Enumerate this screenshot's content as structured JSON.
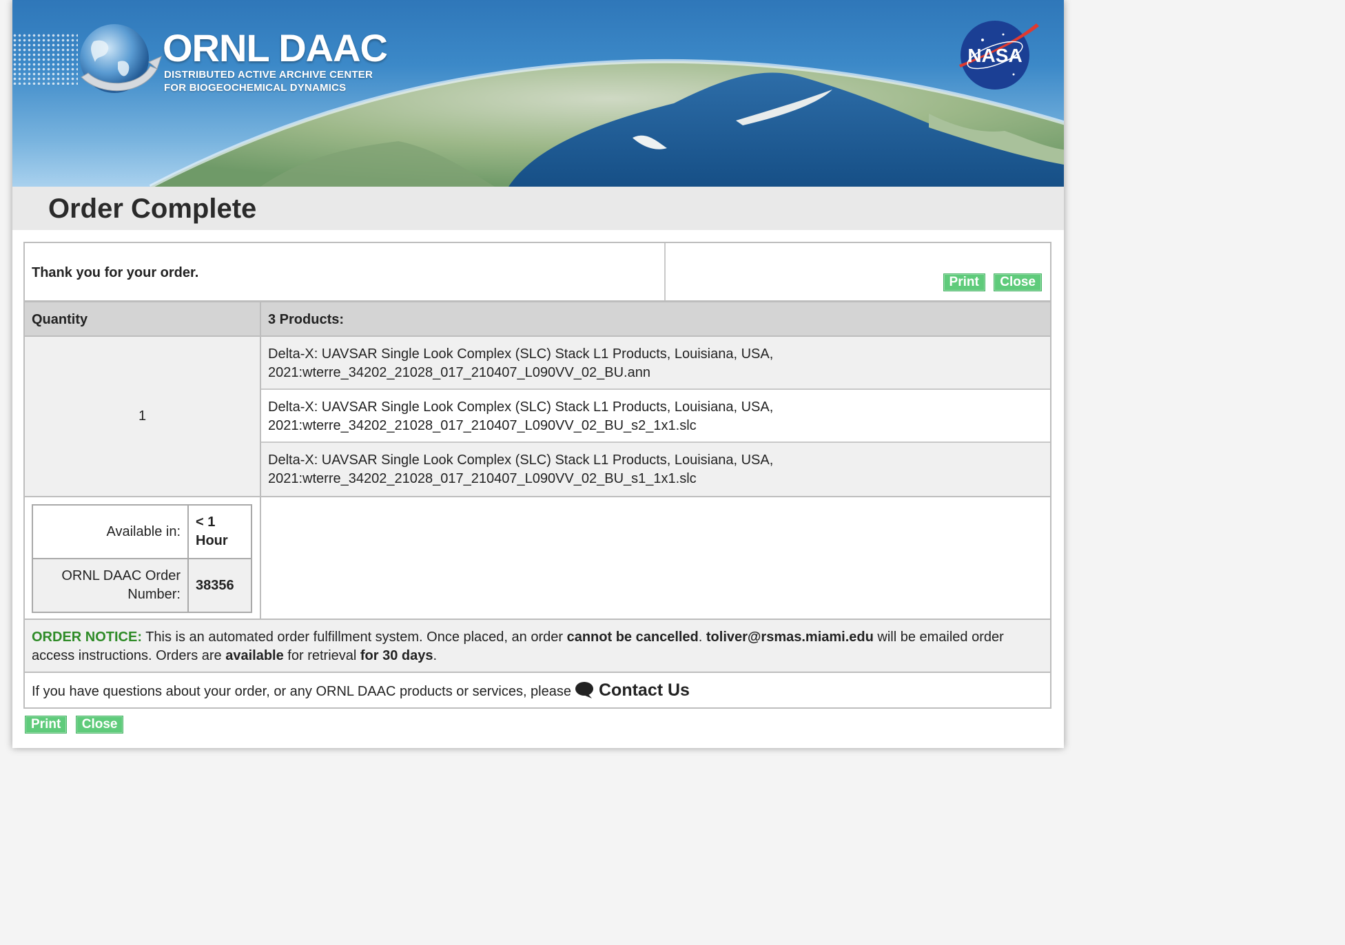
{
  "banner": {
    "logo_title": "ORNL DAAC",
    "logo_subtitle_line1": "DISTRIBUTED ACTIVE ARCHIVE CENTER",
    "logo_subtitle_line2": "FOR BIOGEOCHEMICAL DYNAMICS",
    "nasa_logo": "NASA"
  },
  "page_title": "Order Complete",
  "thanks_text": "Thank you for your order.",
  "actions": {
    "print": "Print",
    "close": "Close"
  },
  "table": {
    "quantity_header": "Quantity",
    "products_header": "3 Products:",
    "quantity": "1",
    "products": [
      {
        "line1": "Delta-X: UAVSAR Single Look Complex (SLC) Stack L1 Products, Louisiana, USA,",
        "line2": "2021:wterre_34202_21028_017_210407_L090VV_02_BU.ann"
      },
      {
        "line1": "Delta-X: UAVSAR Single Look Complex (SLC) Stack L1 Products, Louisiana, USA,",
        "line2": "2021:wterre_34202_21028_017_210407_L090VV_02_BU_s2_1x1.slc"
      },
      {
        "line1": "Delta-X: UAVSAR Single Look Complex (SLC) Stack L1 Products, Louisiana, USA,",
        "line2": "2021:wterre_34202_21028_017_210407_L090VV_02_BU_s1_1x1.slc"
      }
    ]
  },
  "info": {
    "available_label": "Available in:",
    "available_value_line1": "< 1",
    "available_value_line2": "Hour",
    "order_number_label_line1": "ORNL DAAC Order",
    "order_number_label_line2": "Number:",
    "order_number": "38356"
  },
  "notice": {
    "label": "ORDER NOTICE:",
    "text1": " This is an automated order fulfillment system. Once placed, an order ",
    "bold1": "cannot be cancelled",
    "text2": ". ",
    "email": "toliver@rsmas.miami.edu",
    "text3": " will be emailed order access instructions. Orders are ",
    "bold2": "available",
    "text4": " for retrieval ",
    "bold3": "for 30 days",
    "text5": "."
  },
  "contact": {
    "text": "If you have questions about your order, or any ORNL DAAC products or services, please",
    "link": "Contact Us",
    "icon": "speech-bubble-icon"
  },
  "colors": {
    "button_green": "#5fcb7b",
    "notice_green": "#2e8b27",
    "title_bar_bg": "#e9e9e9",
    "header_bg": "#d4d4d4"
  }
}
